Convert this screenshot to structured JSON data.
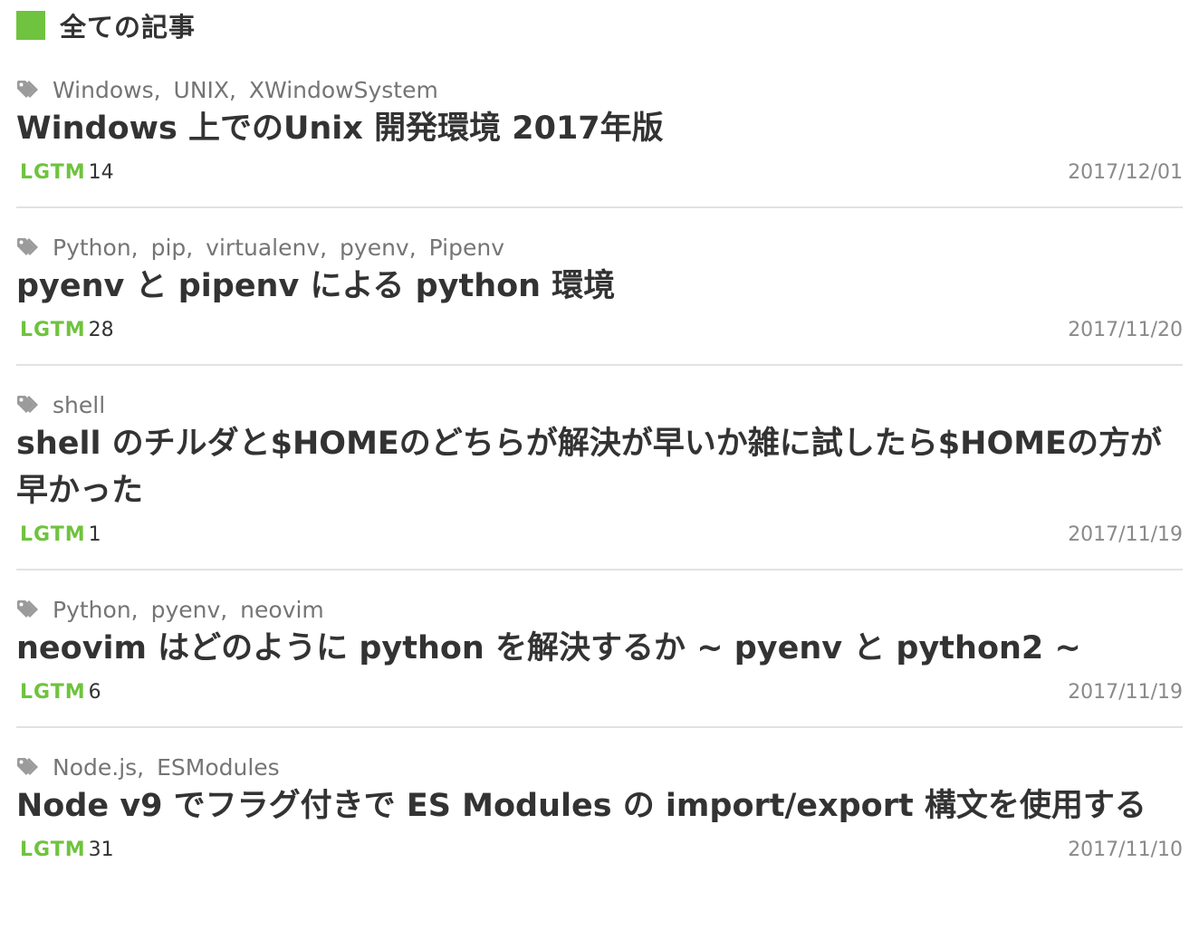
{
  "section": {
    "title": "全ての記事"
  },
  "colors": {
    "accent": "#6fc33e",
    "divider": "#e2e2e2",
    "text": "#333333",
    "muted": "#8a8a8a"
  },
  "icons": {
    "tag": "tags-icon"
  },
  "articles": [
    {
      "tags": [
        "Windows",
        "UNIX",
        "XWindowSystem"
      ],
      "title": "Windows 上でのUnix 開発環境 2017年版",
      "lgtm_label": "LGTM",
      "lgtm_count": "14",
      "date": "2017/12/01"
    },
    {
      "tags": [
        "Python",
        "pip",
        "virtualenv",
        "pyenv",
        "Pipenv"
      ],
      "title": "pyenv と pipenv による python 環境",
      "lgtm_label": "LGTM",
      "lgtm_count": "28",
      "date": "2017/11/20"
    },
    {
      "tags": [
        "shell"
      ],
      "title": "shell のチルダと$HOMEのどちらが解決が早いか雑に試したら$HOMEの方が早かった",
      "lgtm_label": "LGTM",
      "lgtm_count": "1",
      "date": "2017/11/19"
    },
    {
      "tags": [
        "Python",
        "pyenv",
        "neovim"
      ],
      "title": "neovim はどのように python を解決するか ~ pyenv と python2 ~",
      "lgtm_label": "LGTM",
      "lgtm_count": "6",
      "date": "2017/11/19"
    },
    {
      "tags": [
        "Node.js",
        "ESModules"
      ],
      "title": "Node v9 でフラグ付きで ES Modules の import/export 構文を使用する",
      "lgtm_label": "LGTM",
      "lgtm_count": "31",
      "date": "2017/11/10"
    }
  ]
}
